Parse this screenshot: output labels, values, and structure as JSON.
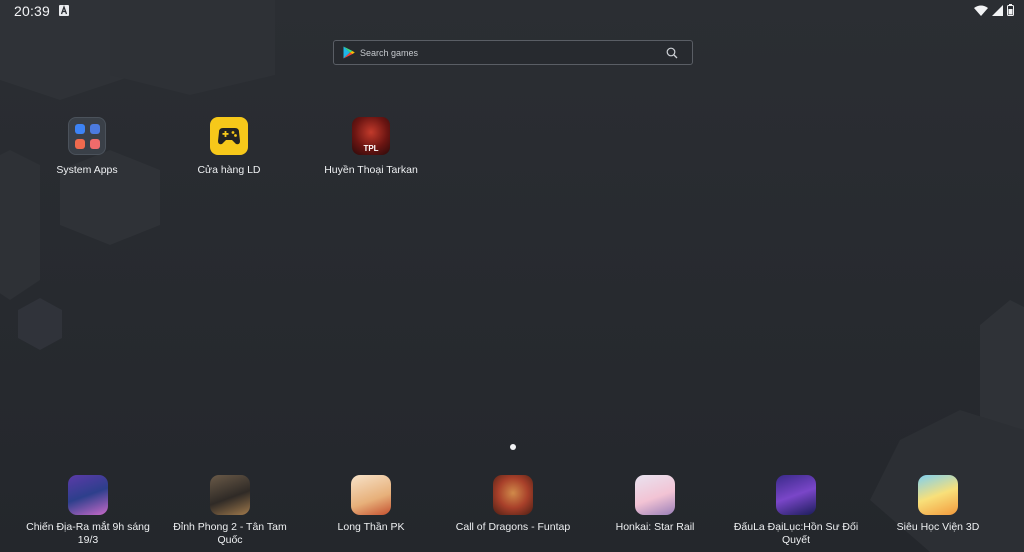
{
  "status_bar": {
    "time": "20:39"
  },
  "search": {
    "placeholder": "Search games"
  },
  "desktop_apps": [
    {
      "label": "System Apps"
    },
    {
      "label": "Cửa hàng LD"
    },
    {
      "label": "Huyền Thoại Tarkan",
      "badge": "TPL"
    }
  ],
  "dock_apps": [
    {
      "label": "Chiến Địa-Ra mắt 9h sáng 19/3"
    },
    {
      "label": "Đỉnh Phong 2 - Tân Tam Quốc"
    },
    {
      "label": "Long Thần PK"
    },
    {
      "label": "Call of Dragons - Funtap"
    },
    {
      "label": "Honkai: Star Rail"
    },
    {
      "label": "ĐấuLa ĐạiLục:Hồn Sư Đối Quyết"
    },
    {
      "label": "Siêu Học Viện 3D"
    }
  ],
  "colors": {
    "background": "#2a2d32",
    "ld_store_yellow": "#f6c81a",
    "text": "#eef0f2"
  }
}
